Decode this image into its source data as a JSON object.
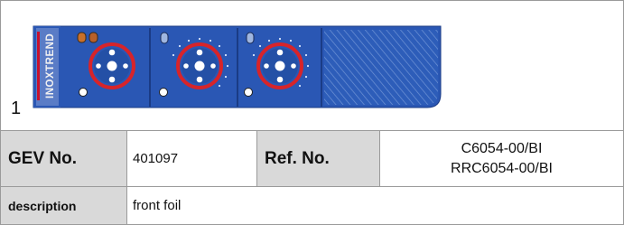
{
  "image": {
    "index_label": "1",
    "brand_text": "INOXTREND",
    "colors": {
      "panel_blue": "#2a57b4",
      "ring_red": "#d7242a",
      "accent": "#c8102e"
    }
  },
  "table": {
    "gev_label": "GEV No.",
    "gev_value": "401097",
    "ref_label": "Ref. No.",
    "ref_values": [
      "C6054-00/BI",
      "RRC6054-00/BI"
    ],
    "description_label": "description",
    "description_value": "front foil"
  }
}
